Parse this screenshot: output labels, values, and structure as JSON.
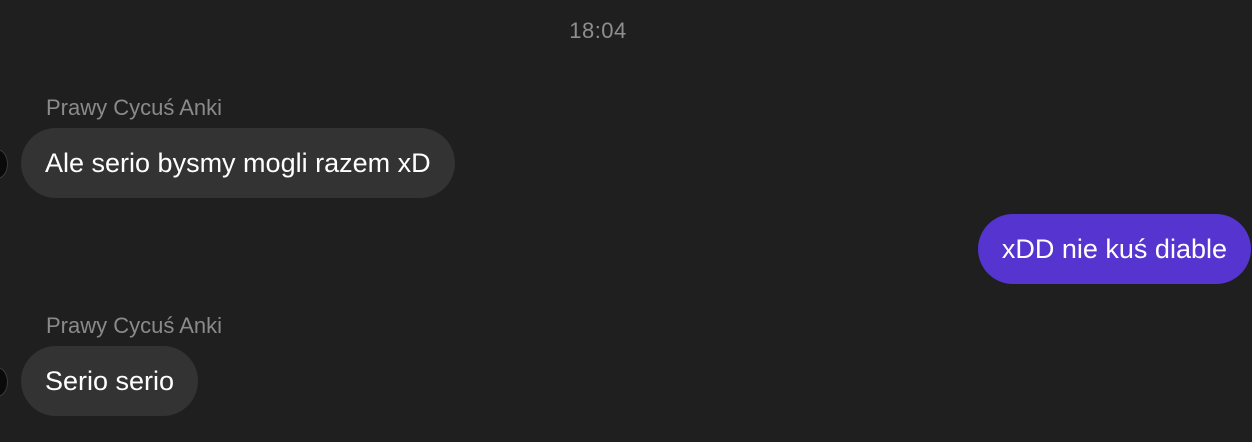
{
  "timestamp": "18:04",
  "messages": [
    {
      "sender": "Prawy Cycuś Anki",
      "text": "Ale serio bysmy mogli razem xD",
      "direction": "incoming"
    },
    {
      "text": "xDD nie kuś diable",
      "direction": "outgoing"
    },
    {
      "sender": "Prawy Cycuś Anki",
      "text": "Serio serio",
      "direction": "incoming"
    }
  ],
  "colors": {
    "background": "#1f1f1f",
    "incoming_bubble": "#333333",
    "outgoing_bubble": "#5634cf",
    "sender_text": "#8a8a8a",
    "timestamp_text": "#8e8e8e"
  }
}
